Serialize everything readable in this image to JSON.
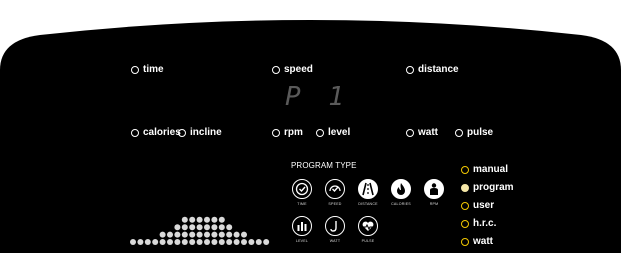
{
  "display": {
    "text": "P 1"
  },
  "top_indicators": [
    {
      "label": "time"
    },
    {
      "label": "speed"
    },
    {
      "label": "distance"
    }
  ],
  "bottom_indicators": [
    {
      "label": "calories"
    },
    {
      "label": "incline"
    },
    {
      "label": "rpm"
    },
    {
      "label": "level"
    },
    {
      "label": "watt"
    },
    {
      "label": "pulse"
    }
  ],
  "program_type": {
    "title": "PROGRAM TYPE",
    "icons": [
      {
        "label": "TIME",
        "icon": "clock-icon"
      },
      {
        "label": "SPEED",
        "icon": "speedometer-icon"
      },
      {
        "label": "DISTANCE",
        "icon": "road-icon"
      },
      {
        "label": "CALORIES",
        "icon": "flame-icon"
      },
      {
        "label": "RPM",
        "icon": "person-icon"
      },
      {
        "label": "LEVEL",
        "icon": "bars-icon"
      },
      {
        "label": "WATT",
        "icon": "watt-curve-icon"
      },
      {
        "label": "PULSE",
        "icon": "heart-pulse-icon"
      }
    ]
  },
  "modes": [
    {
      "label": "manual",
      "active": false
    },
    {
      "label": "program",
      "active": true
    },
    {
      "label": "user",
      "active": false
    },
    {
      "label": "h.r.c.",
      "active": false
    },
    {
      "label": "watt",
      "active": false
    }
  ],
  "profile_columns": [
    1,
    1,
    1,
    1,
    2,
    2,
    3,
    4,
    4,
    4,
    4,
    4,
    4,
    3,
    2,
    2,
    1,
    1,
    1
  ],
  "colors": {
    "panel": "#000000",
    "accent": "#f2c800",
    "led": "#ffffff",
    "dot": "#d9d9d9"
  }
}
